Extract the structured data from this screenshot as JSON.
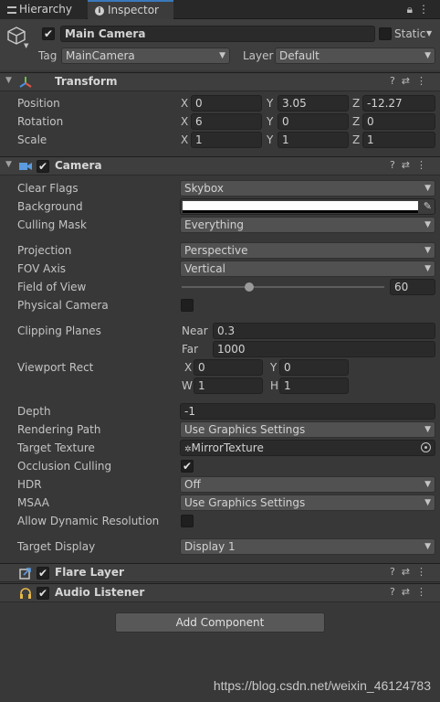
{
  "tabs": {
    "hierarchy": "Hierarchy",
    "inspector": "Inspector"
  },
  "header": {
    "object_name": "Main Camera",
    "static_label": "Static",
    "tag_label": "Tag",
    "tag_value": "MainCamera",
    "layer_label": "Layer",
    "layer_value": "Default"
  },
  "transform": {
    "title": "Transform",
    "position_label": "Position",
    "rotation_label": "Rotation",
    "scale_label": "Scale",
    "axes": [
      "X",
      "Y",
      "Z"
    ],
    "position": [
      "0",
      "3.05",
      "-12.27"
    ],
    "rotation": [
      "6",
      "0",
      "0"
    ],
    "scale": [
      "1",
      "1",
      "1"
    ]
  },
  "camera": {
    "title": "Camera",
    "clear_flags_label": "Clear Flags",
    "clear_flags": "Skybox",
    "background_label": "Background",
    "culling_mask_label": "Culling Mask",
    "culling_mask": "Everything",
    "projection_label": "Projection",
    "projection": "Perspective",
    "fov_axis_label": "FOV Axis",
    "fov_axis": "Vertical",
    "fov_label": "Field of View",
    "fov": "60",
    "physical_label": "Physical Camera",
    "clipping_label": "Clipping Planes",
    "near_label": "Near",
    "near": "0.3",
    "far_label": "Far",
    "far": "1000",
    "viewport_label": "Viewport Rect",
    "vp_x_label": "X",
    "vp_x": "0",
    "vp_y_label": "Y",
    "vp_y": "0",
    "vp_w_label": "W",
    "vp_w": "1",
    "vp_h_label": "H",
    "vp_h": "1",
    "depth_label": "Depth",
    "depth": "-1",
    "render_path_label": "Rendering Path",
    "render_path": "Use Graphics Settings",
    "target_texture_label": "Target Texture",
    "target_texture": "MirrorTexture",
    "occlusion_label": "Occlusion Culling",
    "hdr_label": "HDR",
    "hdr": "Off",
    "msaa_label": "MSAA",
    "msaa": "Use Graphics Settings",
    "dyn_res_label": "Allow Dynamic Resolution",
    "target_display_label": "Target Display",
    "target_display": "Display 1"
  },
  "flare": {
    "title": "Flare Layer"
  },
  "audio": {
    "title": "Audio Listener"
  },
  "add_component": "Add Component",
  "watermark": "https://blog.csdn.net/weixin_46124783",
  "colors": {
    "accent": "#3a79bb",
    "panel": "#383838",
    "header": "#3e3e3e"
  },
  "icons": [
    "lock-icon",
    "menu-icon",
    "cube-icon",
    "transform-icon",
    "camera-icon",
    "help-icon",
    "preset-icon",
    "eyedropper-icon",
    "object-picker-icon",
    "flare-icon",
    "audio-icon"
  ]
}
